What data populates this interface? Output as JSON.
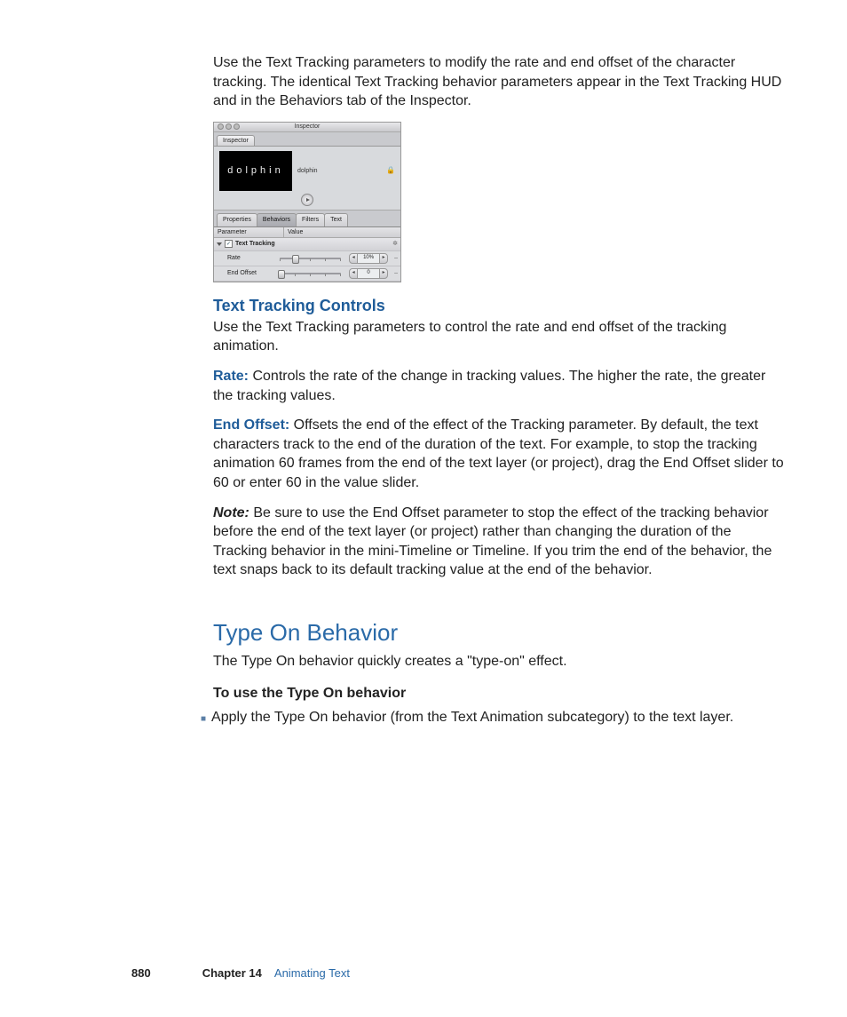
{
  "intro": "Use the Text Tracking parameters to modify the rate and end offset of the character tracking. The identical Text Tracking behavior parameters appear in the Text Tracking HUD and in the Behaviors tab of the Inspector.",
  "panel": {
    "window_title": "Inspector",
    "outer_tab": "Inspector",
    "preview_text": "dolphin",
    "preview_label": "dolphin",
    "tabs": {
      "properties": "Properties",
      "behaviors": "Behaviors",
      "filters": "Filters",
      "text": "Text"
    },
    "header": {
      "parameter": "Parameter",
      "value": "Value"
    },
    "group": "Text Tracking",
    "rows": {
      "rate": {
        "label": "Rate",
        "value": "10%"
      },
      "end_offset": {
        "label": "End Offset",
        "value": "0"
      }
    }
  },
  "section1": {
    "heading": "Text Tracking Controls",
    "intro": "Use the Text Tracking parameters to control the rate and end offset of the tracking animation.",
    "rate_term": "Rate:",
    "rate_body": "  Controls the rate of the change in tracking values. The higher the rate, the greater the tracking values.",
    "endoff_term": "End Offset:",
    "endoff_body": "  Offsets the end of the effect of the Tracking parameter. By default, the text characters track to the end of the duration of the text. For example, to stop the tracking animation 60 frames from the end of the text layer (or project), drag the End Offset slider to 60 or enter 60 in the value slider.",
    "note_term": "Note:",
    "note_body": "  Be sure to use the End Offset parameter to stop the effect of the tracking behavior before the end of the text layer (or project) rather than changing the duration of the Tracking behavior in the mini-Timeline or Timeline. If you trim the end of the behavior, the text snaps back to its default tracking value at the end of the behavior."
  },
  "section2": {
    "heading": "Type On Behavior",
    "intro": "The Type On behavior quickly creates a \"type-on\" effect.",
    "sub": "To use the Type On behavior",
    "bullet": "Apply the Type On behavior (from the Text Animation subcategory) to the text layer."
  },
  "footer": {
    "page": "880",
    "chapter": "Chapter 14",
    "title": "Animating Text"
  }
}
